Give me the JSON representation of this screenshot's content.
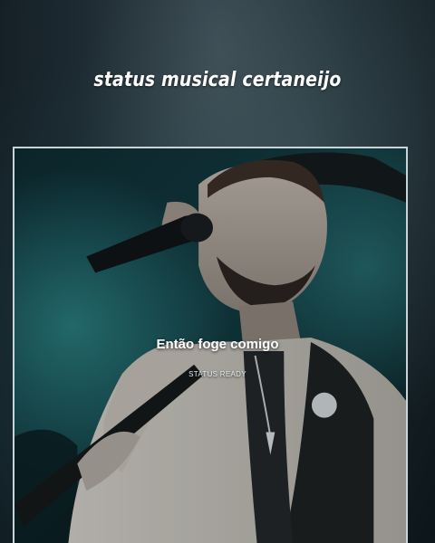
{
  "header": {
    "title": "status musical certaneijo"
  },
  "video": {
    "caption": "Então foge comigo",
    "watermark": "STATUS READY"
  },
  "colors": {
    "background": "#0f1920",
    "frame_border": "#c9d4d8",
    "text": "#ffffff"
  }
}
